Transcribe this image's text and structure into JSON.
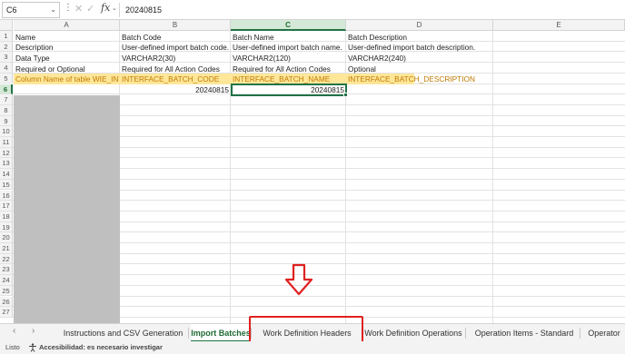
{
  "formula_bar": {
    "name_box": "C6",
    "formula_value": "20240815",
    "dots_icon": "more-vertical-icon",
    "cancel_icon": "close-icon",
    "enter_icon": "check-icon",
    "fx_label": "fx"
  },
  "columns": [
    "A",
    "B",
    "C",
    "D",
    "E"
  ],
  "selected_column": "C",
  "selected_row": "6",
  "rows": [
    "1",
    "2",
    "3",
    "4",
    "5",
    "6",
    "7",
    "8",
    "9",
    "10",
    "11",
    "12",
    "13",
    "14",
    "15",
    "16",
    "17",
    "18",
    "19",
    "20",
    "21",
    "22",
    "23",
    "24",
    "25",
    "26",
    "27"
  ],
  "cells": {
    "r1": {
      "a": "Name",
      "b": "Batch Code",
      "c": "Batch Name",
      "d": "Batch Description"
    },
    "r2": {
      "a": "Description",
      "b": "User-defined import batch code.",
      "c": "User-defined import batch name.",
      "d": "User-defined import batch description."
    },
    "r3": {
      "a": "Data Type",
      "b": "VARCHAR2(30)",
      "c": "VARCHAR2(120)",
      "d": "VARCHAR2(240)"
    },
    "r4": {
      "a": "Required or Optional",
      "b": "Required for All Action Codes",
      "c": "Required for All Action Codes",
      "d": "Optional"
    },
    "r5": {
      "a": "Column Name of table WIE_INT",
      "b": "INTERFACE_BATCH_CODE",
      "c": "INTERFACE_BATCH_NAME",
      "d": "INTERFACE_BATCH_DESCRIPTION"
    },
    "r6": {
      "b": "20240815",
      "c": "20240815"
    }
  },
  "colors": {
    "highlight_row": "#ffe79a",
    "highlight_text": "#c07a00",
    "selection": "#217346",
    "annotation": "#e02020"
  },
  "sheet_tabs": [
    {
      "label": "Instructions and CSV Generation",
      "active": false
    },
    {
      "label": "Import Batches",
      "active": true
    },
    {
      "label": "Work Definition Headers",
      "active": false,
      "annotated": true
    },
    {
      "label": "Work Definition Operations",
      "active": false
    },
    {
      "label": "Operation Items - Standard",
      "active": false
    },
    {
      "label": "Operator",
      "active": false
    }
  ],
  "nav": {
    "prev_icon": "chevron-left-icon",
    "next_icon": "chevron-right-icon"
  },
  "status_bar": {
    "ready_label": "Listo",
    "accessibility_icon": "accessibility-icon",
    "accessibility_label": "Accesibilidad: es necesario investigar"
  },
  "annotation": {
    "arrow_icon": "down-arrow-icon"
  }
}
